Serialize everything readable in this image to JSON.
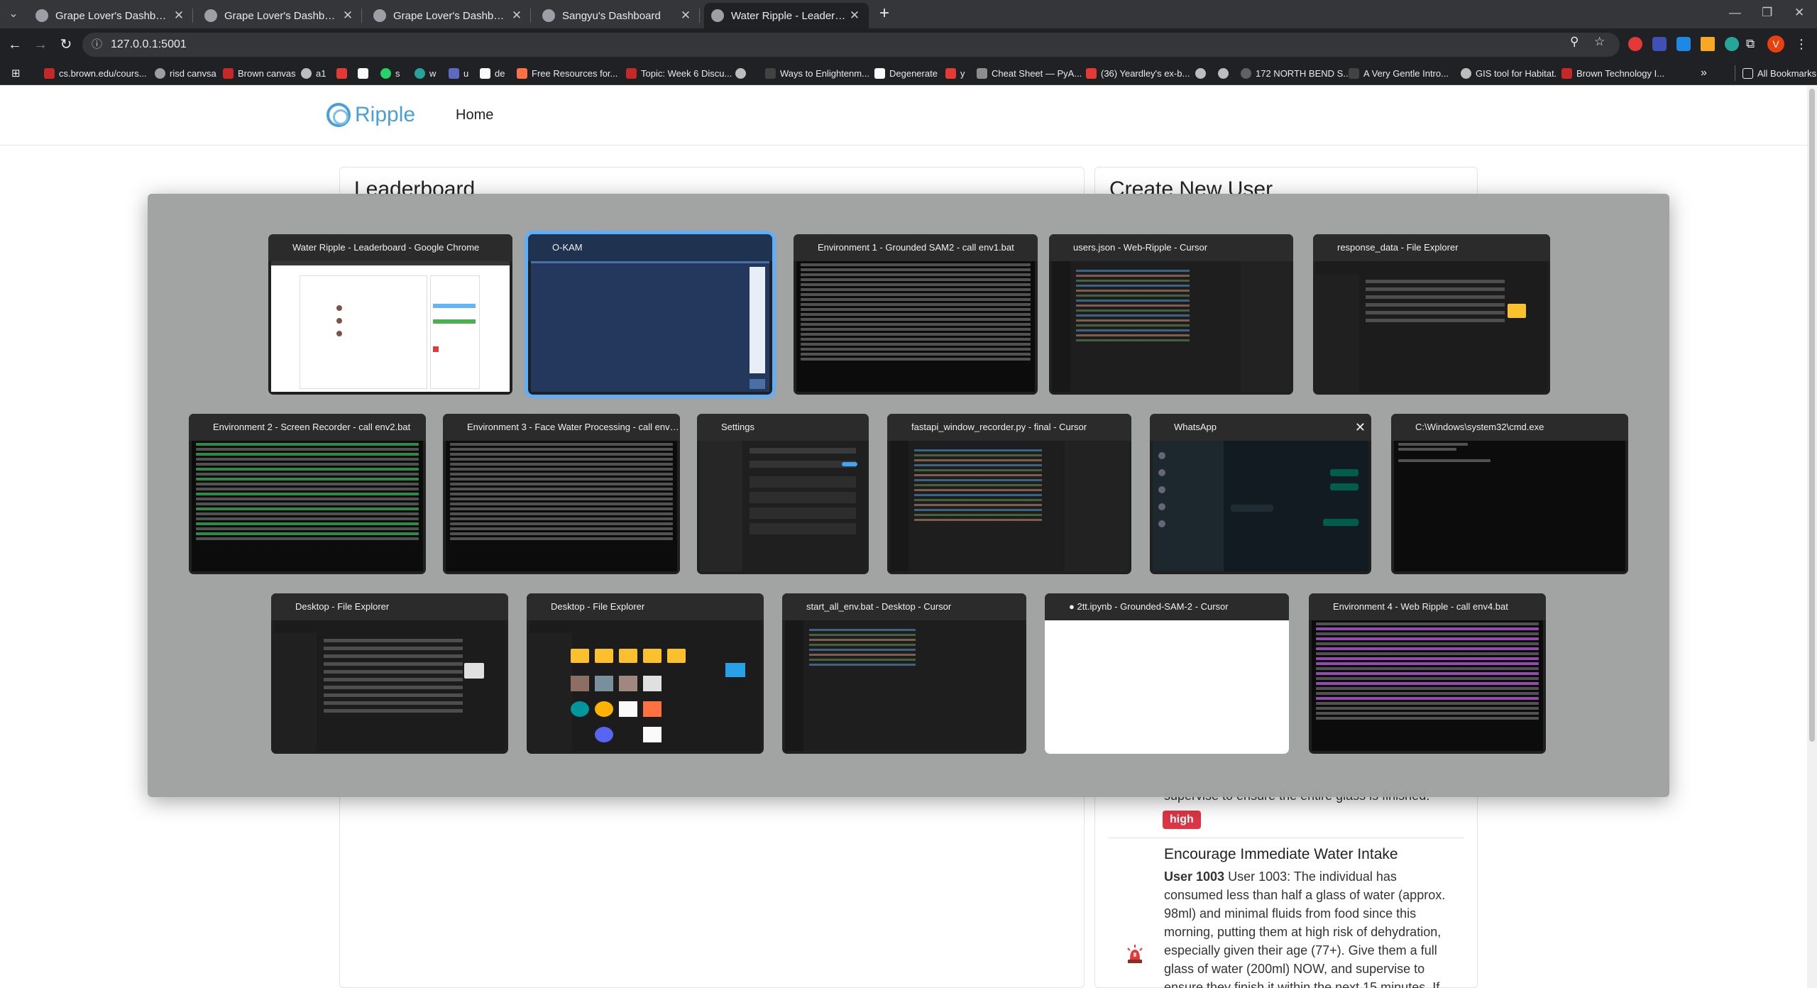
{
  "browser": {
    "tabs": [
      {
        "title": "Grape Lover's Dashboard",
        "active": false
      },
      {
        "title": "Grape Lover's Dashboard",
        "active": false
      },
      {
        "title": "Grape Lover's Dashboard",
        "active": false
      },
      {
        "title": "Sangyu's Dashboard",
        "active": false
      },
      {
        "title": "Water Ripple - Leaderboard",
        "active": true
      }
    ],
    "url": "127.0.0.1:5001",
    "bookmarks": [
      "cs.brown.edu/cours...",
      "risd canvsa",
      "Brown canvas",
      "a1",
      "",
      "",
      "s",
      "w",
      "u",
      "de",
      "Free Resources for...",
      "Topic: Week 6 Discu...",
      "",
      "Ways to Enlightenm...",
      "Degenerate",
      "y",
      "Cheat Sheet — PyA...",
      "(36) Yeardley's ex-b...",
      "",
      "",
      "172 NORTH BEND S...",
      "A Very Gentle Intro...",
      "GIS tool for Habitat.",
      "Brown Technology I..."
    ],
    "all_bookmarks_label": "All Bookmarks",
    "profile_initial": "V"
  },
  "page": {
    "logo_text": "Ripple",
    "nav_home": "Home",
    "leaderboard_title": "Leaderboard",
    "create_user_title": "Create New User",
    "prev_rec_tail": "supervise to ensure the entire glass is finished.",
    "prev_priority": "high",
    "recommendation": {
      "title": "Encourage Immediate Water Intake",
      "user": "User 1003",
      "body": "User 1003: The individual has consumed less than half a glass of water (approx. 98ml) and minimal fluids from food since this morning, putting them at high risk of dehydration, especially given their age (77+). Give them a full glass of water (200ml) NOW, and supervise to ensure they finish it within the next 15 minutes. If they have trouble"
    }
  },
  "switcher": {
    "windows": [
      {
        "title": "Water Ripple - Leaderboard - Google Chrome",
        "icon": "chrome-icon",
        "selected": false
      },
      {
        "title": "O-KAM",
        "icon": "okam-icon",
        "selected": true
      },
      {
        "title": "Environment 1 - Grounded SAM2 - call  env1.bat",
        "icon": "terminal-icon",
        "selected": false
      },
      {
        "title": "users.json - Web-Ripple - Cursor",
        "icon": "cursor-icon",
        "selected": false
      },
      {
        "title": "response_data - File Explorer",
        "icon": "folder-icon",
        "selected": false
      },
      {
        "title": "Environment 2 - Screen Recorder - call  env2.bat",
        "icon": "terminal-icon",
        "selected": false
      },
      {
        "title": "Environment 3 - Face Water Processing - call  env3....",
        "icon": "terminal-icon",
        "selected": false
      },
      {
        "title": "Settings",
        "icon": "gear-icon",
        "selected": false
      },
      {
        "title": "fastapi_window_recorder.py - final - Cursor",
        "icon": "cursor-icon",
        "selected": false
      },
      {
        "title": "WhatsApp",
        "icon": "whatsapp-icon",
        "selected": false
      },
      {
        "title": "C:\\Windows\\system32\\cmd.exe",
        "icon": "terminal-icon",
        "selected": false
      },
      {
        "title": "Desktop - File Explorer",
        "icon": "folder-icon",
        "selected": false
      },
      {
        "title": "Desktop - File Explorer",
        "icon": "folder-icon",
        "selected": false
      },
      {
        "title": "start_all_env.bat - Desktop - Cursor",
        "icon": "cursor-icon",
        "selected": false
      },
      {
        "title": "● 2tt.ipynb - Grounded-SAM-2 - Cursor",
        "icon": "cursor-icon",
        "selected": false
      },
      {
        "title": "Environment 4 - Web Ripple - call  env4.bat",
        "icon": "terminal-icon",
        "selected": false
      }
    ]
  },
  "colors": {
    "chrome_bg": "#202124",
    "tabstrip_bg": "#35363a",
    "accent_blue": "#4a9fd8",
    "selection": "#5ab0ff",
    "priority_high": "#dc3545",
    "switcher_bg": "#9ea0a0"
  }
}
